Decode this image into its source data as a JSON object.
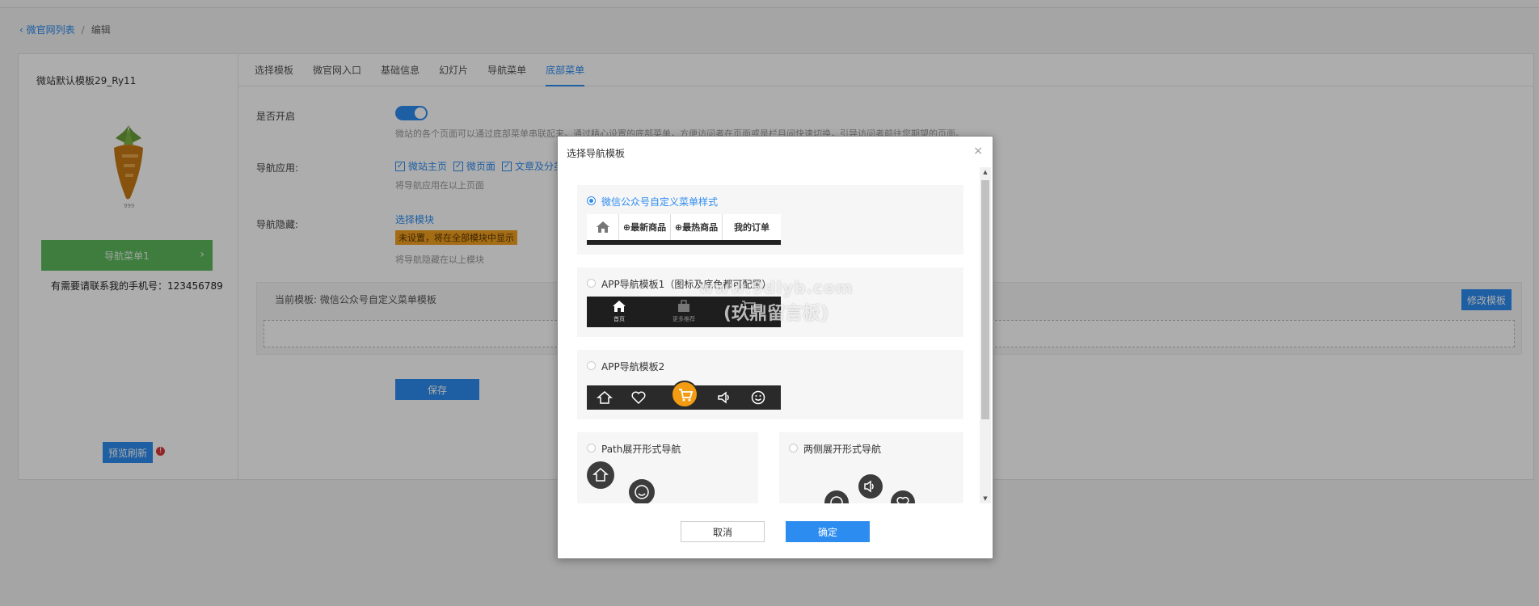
{
  "breadcrumb": {
    "back": "微官网列表",
    "separator": "/",
    "current": "编辑"
  },
  "sidebar": {
    "template_name": "微站默认模板29_Ry11",
    "nav_button": "导航菜单1",
    "nav_arrow": "›",
    "phone_tip": "有需要请联系我的手机号：123456789",
    "preview_button": "预览刷新",
    "warn": "!"
  },
  "tabs": [
    "选择模板",
    "微官网入口",
    "基础信息",
    "幻灯片",
    "导航菜单",
    "底部菜单"
  ],
  "active_tab": 5,
  "form": {
    "enable_label": "是否开启",
    "enable_help": "微站的各个页面可以通过底部菜单串联起来。通过精心设置的底部菜单，方便访问者在页面或是栏目间快速切换，引导访问者前往您期望的页面。",
    "nav_apply_label": "导航应用:",
    "checks": [
      "微站主页",
      "微页面",
      "文章及分类"
    ],
    "check_mark": "✓",
    "nav_apply_help": "将导航应用在以上页面",
    "nav_hide_label": "导航隐藏:",
    "select_module": "选择模块",
    "not_set_tag": "未设置，将在全部模块中显示",
    "nav_hide_help": "将导航隐藏在以上模块",
    "current_template_label": "当前模板: 微信公众号自定义菜单模板",
    "modify_button": "修改模板",
    "save_button": "保存"
  },
  "modal": {
    "title": "选择导航模板",
    "close": "×",
    "options": [
      {
        "label": "微信公众号自定义菜单样式",
        "selected": true
      },
      {
        "label": "APP导航模板1（图标及底色都可配置）",
        "selected": false
      },
      {
        "label": "APP导航模板2",
        "selected": false
      },
      {
        "label": "Path展开形式导航",
        "selected": false
      },
      {
        "label": "两侧展开形式导航",
        "selected": false
      }
    ],
    "preview1": {
      "items": [
        "⊕最新商品",
        "⊕最热商品",
        "我的订单"
      ]
    },
    "preview2": {
      "items": [
        "首页",
        "更多推荐"
      ]
    },
    "scroll_up": "▲",
    "scroll_down": "▼",
    "cancel": "取消",
    "ok": "确定"
  },
  "watermark": {
    "line1": "www.9dlyb.com",
    "line2": "(玖鼎留言板)"
  },
  "colors": {
    "accent": "#2d8cf0",
    "green": "#5cb85c",
    "orange": "#f39c12",
    "tag": "#f0a020"
  }
}
